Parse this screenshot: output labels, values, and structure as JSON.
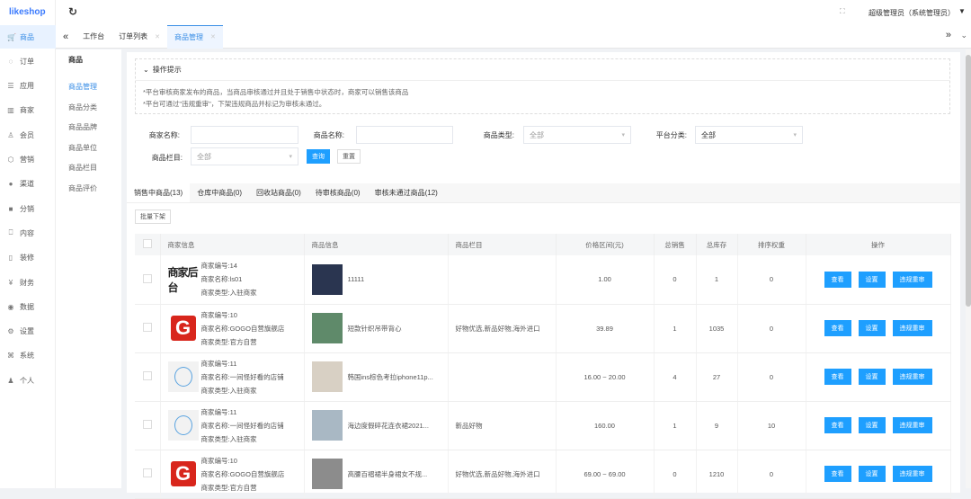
{
  "app": {
    "logo": "likeshop",
    "user": "超级管理员（系统管理员）"
  },
  "sidebar": [
    {
      "label": "商品",
      "icon": "cart-icon",
      "glyph": "🛒"
    },
    {
      "label": "订单",
      "icon": "bell-icon",
      "glyph": "◌"
    },
    {
      "label": "应用",
      "icon": "list-icon",
      "glyph": "☰"
    },
    {
      "label": "商家",
      "icon": "shop-icon",
      "glyph": "▥"
    },
    {
      "label": "会员",
      "icon": "user-icon",
      "glyph": "♙"
    },
    {
      "label": "营销",
      "icon": "cube-icon",
      "glyph": "⬡"
    },
    {
      "label": "渠道",
      "icon": "channel-icon",
      "glyph": "●"
    },
    {
      "label": "分销",
      "icon": "distribution-icon",
      "glyph": "■"
    },
    {
      "label": "内容",
      "icon": "book-icon",
      "glyph": "⎕"
    },
    {
      "label": "装修",
      "icon": "mobile-icon",
      "glyph": "▯"
    },
    {
      "label": "财务",
      "icon": "yuan-icon",
      "glyph": "¥"
    },
    {
      "label": "数据",
      "icon": "globe-icon",
      "glyph": "◉"
    },
    {
      "label": "设置",
      "icon": "gear-icon",
      "glyph": "⚙"
    },
    {
      "label": "系统",
      "icon": "system-icon",
      "glyph": "⌘"
    },
    {
      "label": "个人",
      "icon": "person-icon",
      "glyph": "♟"
    }
  ],
  "tabs": [
    {
      "label": "工作台"
    },
    {
      "label": "订单列表"
    },
    {
      "label": "商品管理"
    }
  ],
  "subnav": {
    "title": "商品",
    "items": [
      "商品管理",
      "商品分类",
      "商品品牌",
      "商品单位",
      "商品栏目",
      "商品评价"
    ]
  },
  "tips": {
    "title": "操作提示",
    "lines": [
      "*平台审核商家发布的商品，当商品审核通过并且处于销售中状态时，商家可以销售该商品",
      "*平台可通过\"违规重审\"，下架违规商品并标记为审核未通过。"
    ]
  },
  "filters": {
    "merchant_name": "商家名称:",
    "goods_name": "商品名称:",
    "goods_type": "商品类型:",
    "goods_type_value": "全部",
    "platform_cat": "平台分类:",
    "platform_cat_value": "全部",
    "column": "商品栏目:",
    "column_value": "全部",
    "query": "查询",
    "reset": "重置"
  },
  "status_tabs": [
    "销售中商品(13)",
    "仓库中商品(0)",
    "回收站商品(0)",
    "待审核商品(0)",
    "审核未通过商品(12)"
  ],
  "batch_off": "批量下架",
  "columns": [
    "商家信息",
    "商品信息",
    "商品栏目",
    "价格区间(元)",
    "总销售",
    "总库存",
    "排序权重",
    "操作"
  ],
  "ops": [
    "查看",
    "设置",
    "违规重审"
  ],
  "rows": [
    {
      "logo": "text",
      "logo_text": "商家后台",
      "id": "商家编号:14",
      "name": "商家名称:ls01",
      "type": "商家类型:入驻商家",
      "goods": "11111",
      "img": "#2a3550",
      "column": "",
      "price": "1.00",
      "sales": "0",
      "stock": "1",
      "sort": "0"
    },
    {
      "logo": "g",
      "id": "商家编号:10",
      "name": "商家名称:GOGO自营旗舰店",
      "type": "商家类型:官方自营",
      "goods": "短款针织吊带背心",
      "img": "#5f8a6a",
      "column": "好物优选,新品好物,海外进口",
      "price": "39.89",
      "sales": "1",
      "stock": "1035",
      "sort": "0"
    },
    {
      "logo": "circle",
      "id": "商家编号:11",
      "name": "商家名称:一间怪好看的店铺",
      "type": "商家类型:入驻商家",
      "goods": "韩国ins棕色考拉iphone11p...",
      "img": "#d8d0c4",
      "column": "",
      "price": "16.00 ~ 20.00",
      "sales": "4",
      "stock": "27",
      "sort": "0"
    },
    {
      "logo": "circle",
      "id": "商家编号:11",
      "name": "商家名称:一间怪好看的店铺",
      "type": "商家类型:入驻商家",
      "goods": "海边度假碎花连衣裙2021...",
      "img": "#a9b8c4",
      "column": "新品好物",
      "price": "160.00",
      "sales": "1",
      "stock": "9",
      "sort": "10"
    },
    {
      "logo": "g",
      "id": "商家编号:10",
      "name": "商家名称:GOGO自营旗舰店",
      "type": "商家类型:官方自营",
      "goods": "高腰百褶裙半身裙女不规...",
      "img": "#8c8c8c",
      "column": "好物优选,新品好物,海外进口",
      "price": "69.00 ~ 69.00",
      "sales": "0",
      "stock": "1210",
      "sort": "0"
    }
  ]
}
